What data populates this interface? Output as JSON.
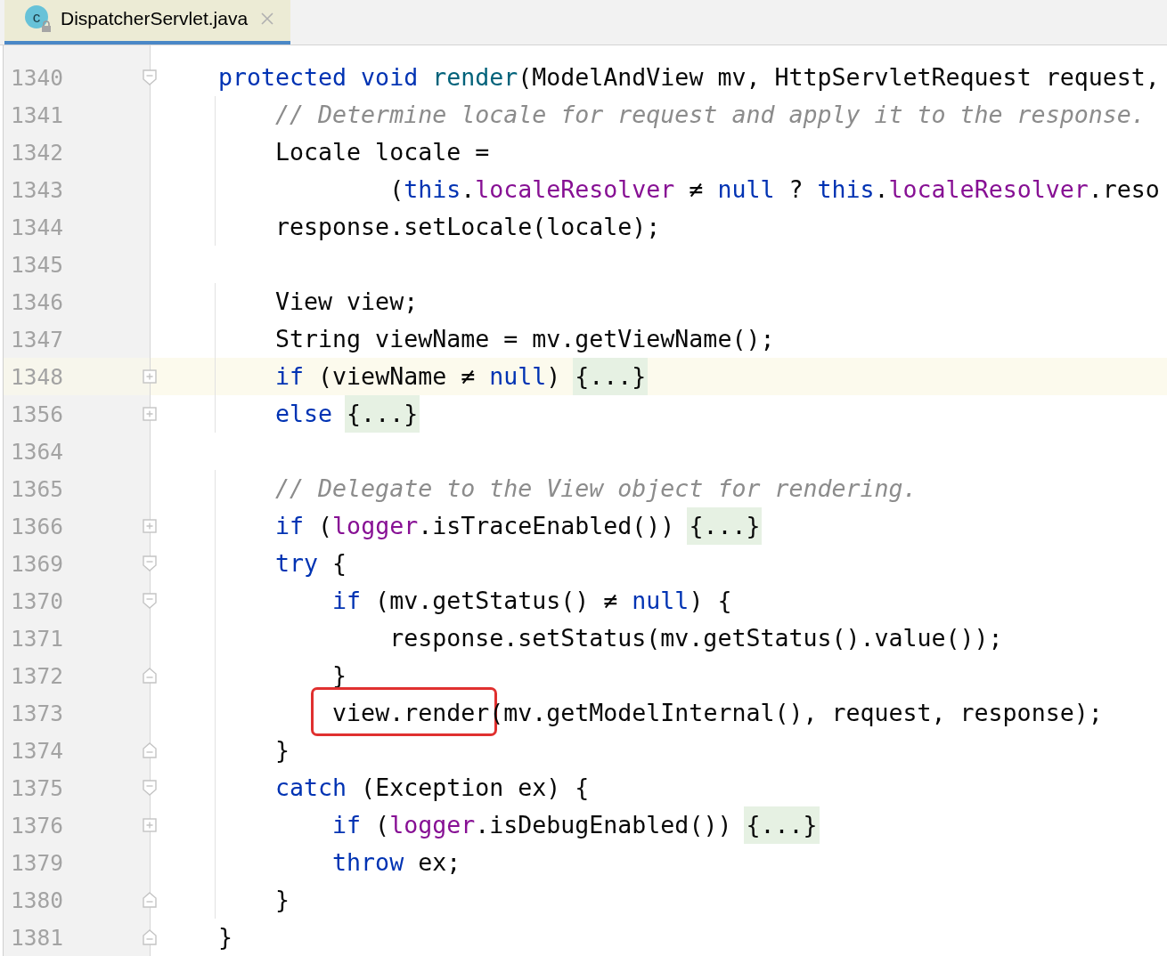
{
  "tab": {
    "title": "DispatcherServlet.java",
    "icon_letter": "c",
    "selected": true
  },
  "lines": [
    {
      "number": "1340",
      "kind": "fold_start",
      "current": false,
      "code": [
        {
          "text": "protected void ",
          "kind": "keyword"
        },
        {
          "text": "render",
          "kind": "function"
        },
        {
          "text": "(ModelAndView mv, HttpServletRequest request,",
          "kind": "plain"
        }
      ]
    },
    {
      "number": "1341",
      "kind": "plain",
      "current": false,
      "code": [
        {
          "text": "    // Determine locale for request and apply it to the response.",
          "kind": "comment"
        }
      ]
    },
    {
      "number": "1342",
      "kind": "plain",
      "current": false,
      "code": [
        {
          "text": "    Locale locale =",
          "kind": "plain"
        }
      ]
    },
    {
      "number": "1343",
      "kind": "plain",
      "current": false,
      "code": [
        {
          "text": "            (",
          "kind": "plain"
        },
        {
          "text": "this",
          "kind": "keyword"
        },
        {
          "text": ".",
          "kind": "plain"
        },
        {
          "text": "localeResolver",
          "kind": "field"
        },
        {
          "text": " ≠ ",
          "kind": "plain"
        },
        {
          "text": "null",
          "kind": "keyword"
        },
        {
          "text": " ? ",
          "kind": "plain"
        },
        {
          "text": "this",
          "kind": "keyword"
        },
        {
          "text": ".",
          "kind": "plain"
        },
        {
          "text": "localeResolver",
          "kind": "field"
        },
        {
          "text": ".reso",
          "kind": "plain"
        }
      ]
    },
    {
      "number": "1344",
      "kind": "plain",
      "current": false,
      "code": [
        {
          "text": "    response.setLocale(locale);",
          "kind": "plain"
        }
      ]
    },
    {
      "number": "1345",
      "kind": "plain",
      "current": false
    },
    {
      "number": "1346",
      "kind": "plain",
      "current": false,
      "code": [
        {
          "text": "    View view;",
          "kind": "plain"
        }
      ]
    },
    {
      "number": "1347",
      "kind": "plain",
      "current": false,
      "code": [
        {
          "text": "    String viewName = mv.getViewName();",
          "kind": "plain"
        }
      ]
    },
    {
      "number": "1348",
      "kind": "folded",
      "current": true,
      "code": [
        {
          "text": "    if",
          "kind": "keyword"
        },
        {
          "text": " (viewName ≠ ",
          "kind": "plain"
        },
        {
          "text": "null",
          "kind": "keyword"
        },
        {
          "text": ") ",
          "kind": "plain"
        },
        {
          "text": "{...}",
          "kind": "folded"
        }
      ]
    },
    {
      "number": "1356",
      "kind": "folded",
      "current": false,
      "code": [
        {
          "text": "    else ",
          "kind": "keyword"
        },
        {
          "text": "{...}",
          "kind": "folded"
        }
      ]
    },
    {
      "number": "1364",
      "kind": "plain",
      "current": false
    },
    {
      "number": "1365",
      "kind": "plain",
      "current": false,
      "code": [
        {
          "text": "    // Delegate to the View object for rendering.",
          "kind": "comment"
        }
      ]
    },
    {
      "number": "1366",
      "kind": "folded",
      "current": false,
      "code": [
        {
          "text": "    if",
          "kind": "keyword"
        },
        {
          "text": " (",
          "kind": "plain"
        },
        {
          "text": "logger",
          "kind": "field"
        },
        {
          "text": ".isTraceEnabled()) ",
          "kind": "plain"
        },
        {
          "text": "{...}",
          "kind": "folded"
        }
      ]
    },
    {
      "number": "1369",
      "kind": "fold_start",
      "current": false,
      "code": [
        {
          "text": "    try",
          "kind": "keyword"
        },
        {
          "text": " {",
          "kind": "plain"
        }
      ]
    },
    {
      "number": "1370",
      "kind": "fold_start",
      "current": false,
      "code": [
        {
          "text": "        if",
          "kind": "keyword"
        },
        {
          "text": " (mv.getStatus() ≠ ",
          "kind": "plain"
        },
        {
          "text": "null",
          "kind": "keyword"
        },
        {
          "text": ") {",
          "kind": "plain"
        }
      ]
    },
    {
      "number": "1371",
      "kind": "plain",
      "current": false,
      "code": [
        {
          "text": "            response.setStatus(mv.getStatus().value());",
          "kind": "plain"
        }
      ]
    },
    {
      "number": "1372",
      "kind": "fold_end",
      "current": false,
      "code": [
        {
          "text": "        }",
          "kind": "plain"
        }
      ]
    },
    {
      "number": "1373",
      "kind": "plain",
      "current": false,
      "code": [
        {
          "text": "        view.render",
          "kind": "plain",
          "boxed": true
        },
        {
          "text": "(mv.getModelInternal(), request, response);",
          "kind": "plain"
        }
      ]
    },
    {
      "number": "1374",
      "kind": "fold_end",
      "current": false,
      "code": [
        {
          "text": "    }",
          "kind": "plain"
        }
      ]
    },
    {
      "number": "1375",
      "kind": "fold_start",
      "current": false,
      "code": [
        {
          "text": "    catch",
          "kind": "keyword"
        },
        {
          "text": " (Exception ex) {",
          "kind": "plain"
        }
      ]
    },
    {
      "number": "1376",
      "kind": "folded",
      "current": false,
      "code": [
        {
          "text": "        if",
          "kind": "keyword"
        },
        {
          "text": " (",
          "kind": "plain"
        },
        {
          "text": "logger",
          "kind": "field"
        },
        {
          "text": ".isDebugEnabled()) ",
          "kind": "plain"
        },
        {
          "text": "{...}",
          "kind": "folded"
        }
      ]
    },
    {
      "number": "1379",
      "kind": "plain",
      "current": false,
      "code": [
        {
          "text": "        throw",
          "kind": "keyword"
        },
        {
          "text": " ex;",
          "kind": "plain"
        }
      ]
    },
    {
      "number": "1380",
      "kind": "fold_end",
      "current": false,
      "code": [
        {
          "text": "    }",
          "kind": "plain"
        }
      ]
    },
    {
      "number": "1381",
      "kind": "fold_end",
      "current": false,
      "code": [
        {
          "text": "}",
          "kind": "plain"
        }
      ]
    }
  ]
}
